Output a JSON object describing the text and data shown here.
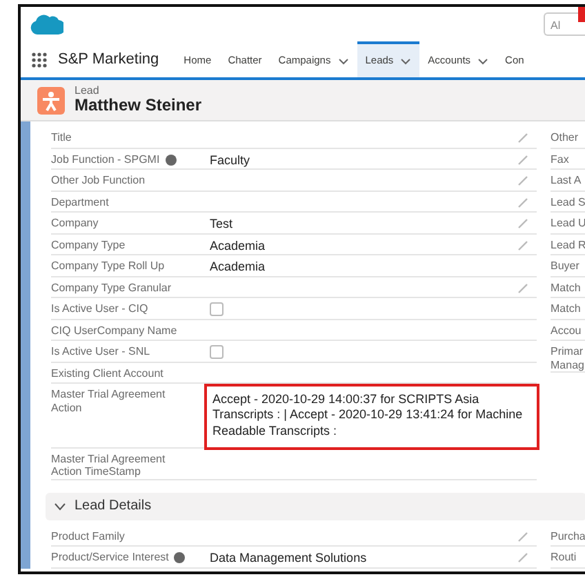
{
  "header": {
    "search_text": "Al"
  },
  "nav": {
    "app_name": "S&P Marketing",
    "tabs": [
      {
        "label": "Home",
        "dropdown": false,
        "selected": false
      },
      {
        "label": "Chatter",
        "dropdown": false,
        "selected": false
      },
      {
        "label": "Campaigns",
        "dropdown": true,
        "selected": false
      },
      {
        "label": "Leads",
        "dropdown": true,
        "selected": true
      },
      {
        "label": "Accounts",
        "dropdown": true,
        "selected": false
      },
      {
        "label": "Con",
        "dropdown": false,
        "selected": false
      }
    ]
  },
  "record": {
    "type": "Lead",
    "name": "Matthew Steiner"
  },
  "fields_left": [
    {
      "label": "Title",
      "kind": "text",
      "info": false,
      "editable": true
    },
    {
      "label": "Job Function - SPGMI",
      "value": "Faculty",
      "kind": "text",
      "info": true,
      "editable": true
    },
    {
      "label": "Other Job Function",
      "kind": "text",
      "info": false,
      "editable": true
    },
    {
      "label": "Department",
      "kind": "text",
      "info": false,
      "editable": true
    },
    {
      "label": "Company",
      "value": "Test",
      "kind": "text",
      "info": false,
      "editable": true
    },
    {
      "label": "Company Type",
      "value": "Academia",
      "kind": "text",
      "info": false,
      "editable": true
    },
    {
      "label": "Company Type Roll Up",
      "value": "Academia",
      "kind": "text",
      "info": false,
      "editable": false
    },
    {
      "label": "Company Type Granular",
      "kind": "text",
      "info": false,
      "editable": true
    },
    {
      "label": "Is Active User - CIQ",
      "kind": "checkbox",
      "checked": false,
      "info": false,
      "editable": false
    },
    {
      "label": "CIQ UserCompany Name",
      "kind": "text",
      "info": false,
      "editable": false
    },
    {
      "label": "Is Active User - SNL",
      "kind": "checkbox",
      "checked": false,
      "info": false,
      "editable": false
    },
    {
      "label": "Existing Client Account",
      "kind": "text",
      "info": false,
      "editable": false
    },
    {
      "label": "Master Trial Agreement Action",
      "value": "Accept - 2020-10-29 14:00:37 for SCRIPTS Asia Transcripts : | Accept - 2020-10-29 13:41:24 for Machine Readable Transcripts :",
      "kind": "text",
      "info": false,
      "editable": false,
      "highlighted": true
    },
    {
      "label": "Master Trial Agreement Action TimeStamp",
      "kind": "text",
      "info": false,
      "editable": false
    }
  ],
  "fields_right": [
    [
      "Other"
    ],
    [
      "Fax"
    ],
    [
      "Last A"
    ],
    [
      "Lead S"
    ],
    [
      "Lead U"
    ],
    [
      "Lead R"
    ],
    [
      "Buyer"
    ],
    [
      "Match"
    ],
    [
      "Match"
    ],
    [
      "Accou"
    ],
    [
      "Primar",
      "Manag"
    ]
  ],
  "section": {
    "title": "Lead Details",
    "expanded": true,
    "fields_left": [
      {
        "label": "Product Family",
        "info": false,
        "editable": true
      },
      {
        "label": "Product/Service Interest",
        "value": "Data Management Solutions",
        "info": true,
        "editable": true
      }
    ],
    "fields_right": [
      [
        "Purcha"
      ],
      [
        "Routi"
      ]
    ]
  }
}
